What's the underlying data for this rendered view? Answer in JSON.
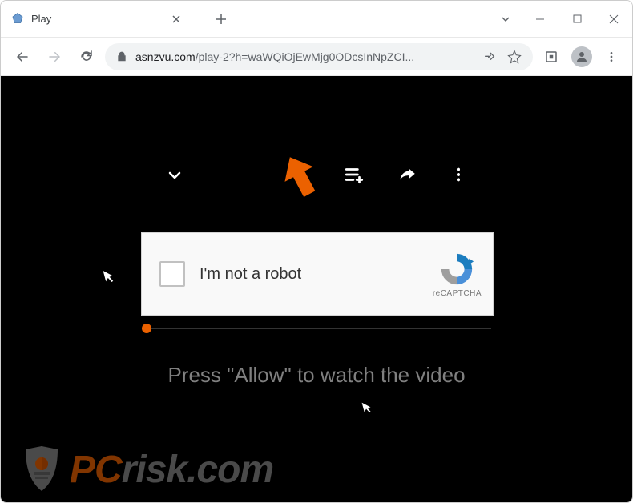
{
  "window": {
    "tab_title": "Play",
    "url_domain": "asnzvu.com",
    "url_path": "/play-2?h=waWQiOjEwMjg0ODcsInNpZCI...",
    "minimize": "–",
    "maximize": "□",
    "close": "×",
    "new_tab": "+"
  },
  "captcha": {
    "label": "I'm not a robot",
    "brand": "reCAPTCHA"
  },
  "page": {
    "instruction": "Press \"Allow\" to watch the video"
  },
  "watermark": {
    "prefix": "PC",
    "suffix": "risk.com"
  },
  "icons": {
    "back": "back-icon",
    "forward": "forward-icon",
    "reload": "reload-icon",
    "lock": "lock-icon",
    "share": "share-icon",
    "star": "star-icon",
    "extension": "extension-icon",
    "profile": "profile-icon",
    "menu": "menu-icon",
    "search_tabs": "chevron-down-icon",
    "tab_close": "close-icon",
    "playlist_add": "playlist-add-icon",
    "forward_share": "forward-share-icon",
    "more_vert": "more-vert-icon",
    "expand": "chevron-down-icon"
  }
}
